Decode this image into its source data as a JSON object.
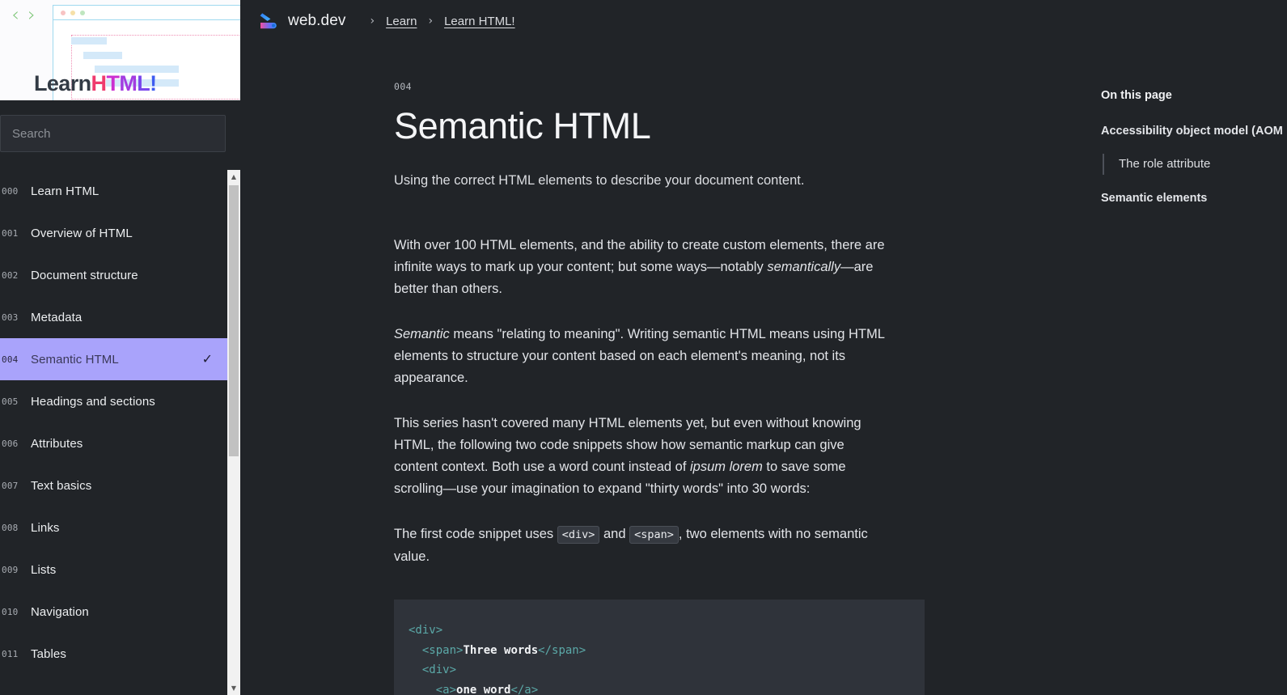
{
  "hero": {
    "chevron_left": "‹",
    "chevron_right": "›",
    "wordmark_learn": "Learn",
    "wordmark_h": "H",
    "wordmark_t": "T",
    "wordmark_m": "M",
    "wordmark_l": "L",
    "wordmark_bang": "!",
    "colors": {
      "frame_blue": "#9fd9ef",
      "dotted_pink": "#f08fb4",
      "bar_blue": "#d4e9f9"
    }
  },
  "search": {
    "placeholder": "Search",
    "value": ""
  },
  "sidebar": {
    "scrollbar": {
      "up_arrow": "▲",
      "down_arrow": "▼"
    },
    "items": [
      {
        "num": "000",
        "label": "Learn HTML",
        "active": false
      },
      {
        "num": "001",
        "label": "Overview of HTML",
        "active": false
      },
      {
        "num": "002",
        "label": "Document structure",
        "active": false
      },
      {
        "num": "003",
        "label": "Metadata",
        "active": false
      },
      {
        "num": "004",
        "label": "Semantic HTML",
        "active": true,
        "check": "✓"
      },
      {
        "num": "005",
        "label": "Headings and sections",
        "active": false
      },
      {
        "num": "006",
        "label": "Attributes",
        "active": false
      },
      {
        "num": "007",
        "label": "Text basics",
        "active": false
      },
      {
        "num": "008",
        "label": "Links",
        "active": false
      },
      {
        "num": "009",
        "label": "Lists",
        "active": false
      },
      {
        "num": "010",
        "label": "Navigation",
        "active": false
      },
      {
        "num": "011",
        "label": "Tables",
        "active": false
      }
    ]
  },
  "breadcrumb": {
    "brand": "web.dev",
    "separator": "›",
    "link1": "Learn",
    "link2": "Learn HTML!"
  },
  "article": {
    "eyebrow": "004",
    "title": "Semantic HTML",
    "lede": "Using the correct HTML elements to describe your document content.",
    "p1_a": "With over 100 HTML elements, and the ability to create custom elements, there are infinite ways to mark up your content; but some ways—notably ",
    "p1_em": "semantically",
    "p1_b": "—are better than others.",
    "p2_em": "Semantic",
    "p2_a": " means \"relating to meaning\". Writing semantic HTML means using HTML elements to structure your content based on each element's meaning, not its appearance.",
    "p3_a": "This series hasn't covered many HTML elements yet, but even without knowing HTML, the following two code snippets show how semantic markup can give content context. Both use a word count instead of ",
    "p3_em": "ipsum lorem",
    "p3_b": " to save some scrolling—use your imagination to expand \"thirty words\" into 30 words:",
    "p4_a": "The first code snippet uses ",
    "p4_code1": "<div>",
    "p4_mid": " and ",
    "p4_code2": "<span>",
    "p4_b": ", two elements with no semantic value.",
    "code_lines": [
      [
        {
          "t": "tag",
          "s": "<div>"
        }
      ],
      [
        {
          "t": "sp",
          "s": "  "
        },
        {
          "t": "tag",
          "s": "<span>"
        },
        {
          "t": "txt",
          "s": "Three words"
        },
        {
          "t": "tag",
          "s": "</span>"
        }
      ],
      [
        {
          "t": "sp",
          "s": "  "
        },
        {
          "t": "tag",
          "s": "<div>"
        }
      ],
      [
        {
          "t": "sp",
          "s": "    "
        },
        {
          "t": "tag",
          "s": "<a>"
        },
        {
          "t": "txt",
          "s": "one word"
        },
        {
          "t": "tag",
          "s": "</a>"
        }
      ]
    ]
  },
  "toc": {
    "title": "On this page",
    "items": [
      {
        "label": "Accessibility object model (AOM",
        "sub": false
      },
      {
        "label": "The role attribute",
        "sub": true
      },
      {
        "label": "Semantic elements",
        "sub": false
      }
    ]
  },
  "colors": {
    "page_bg": "#212428",
    "code_bg": "#2f333a",
    "active_nav": "#a9a3fb",
    "accent_tag": "#5ba9a8"
  }
}
